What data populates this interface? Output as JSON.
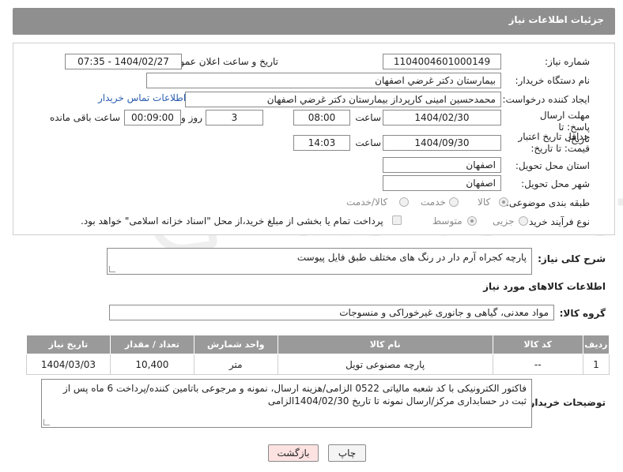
{
  "header": {
    "title": "جزئیات اطلاعات نیاز"
  },
  "form": {
    "need_number_label": "شماره نیاز:",
    "need_number": "1104004601000149",
    "announce_label": "تاریخ و ساعت اعلان عمومی:",
    "announce_value": "1404/02/27 - 07:35",
    "buyer_org_label": "نام دستگاه خریدار:",
    "buyer_org": "بیمارستان دکتر غرضي اصفهان",
    "creator_label": "ایجاد کننده درخواست:",
    "creator": "محمدحسین امینی کارپرداز بیمارستان دکتر غرضي اصفهان",
    "contact_link": "اطلاعات تماس خریدار",
    "deadline_label": "مهلت ارسال پاسخ: تا تاریخ:",
    "deadline_date": "1404/02/30",
    "time_label": "ساعت",
    "deadline_time": "08:00",
    "days_value": "3",
    "days_label": "روز و",
    "remaining_time": "00:09:00",
    "remaining_label": "ساعت باقی مانده",
    "price_validity_label": "حداقل تاریخ اعتبار قیمت: تا تاریخ:",
    "price_validity_date": "1404/09/30",
    "price_validity_time": "14:03",
    "delivery_province_label": "استان محل تحویل:",
    "delivery_province": "اصفهان",
    "delivery_city_label": "شهر محل تحویل:",
    "delivery_city": "اصفهان",
    "category_label": "طبقه بندی موضوعی:",
    "category_options": [
      "کالا",
      "خدمت",
      "کالا/خدمت"
    ],
    "purchase_type_label": "نوع فرآیند خرید :",
    "purchase_options": [
      "جزیی",
      "متوسط"
    ],
    "payment_note": "پرداخت تمام یا بخشی از مبلغ خرید،از محل \"اسناد خزانه اسلامی\" خواهد بود."
  },
  "description": {
    "label": "شرح کلی نیاز:",
    "text": "پارچه کجراه آرم دار در رنگ های مختلف طبق فایل پیوست"
  },
  "goods": {
    "section_title": "اطلاعات کالاهای مورد نیاز",
    "group_label": "گروه کالا:",
    "group_value": "مواد معدنی، گیاهی و جانوری غیرخوراکی و منسوجات",
    "columns": [
      "ردیف",
      "کد کالا",
      "نام کالا",
      "واحد شمارش",
      "تعداد / مقدار",
      "تاریخ نیاز"
    ],
    "rows": [
      [
        "1",
        "--",
        "پارچه مصنوعی تویل",
        "متر",
        "10,400",
        "1404/03/03"
      ]
    ]
  },
  "buyer_notes": {
    "label": "توضیحات خریدار:",
    "text": "فاکتور الکترونیکی با کد شعبه مالیاتی 0522 الزامی/هزینه ارسال، نمونه و مرجوعی باتامین کننده/پرداخت 6 ماه پس از ثبت در حسابداری مرکز/ارسال نمونه تا تاریخ 1404/02/30الزامی"
  },
  "buttons": {
    "print": "چاپ",
    "back": "بازگشت"
  },
  "watermark": {
    "text": "AriaTender.neT"
  },
  "colors": {
    "header": "#8f8f8f",
    "link": "#2a5db0",
    "back_button": "#fde2e2"
  }
}
